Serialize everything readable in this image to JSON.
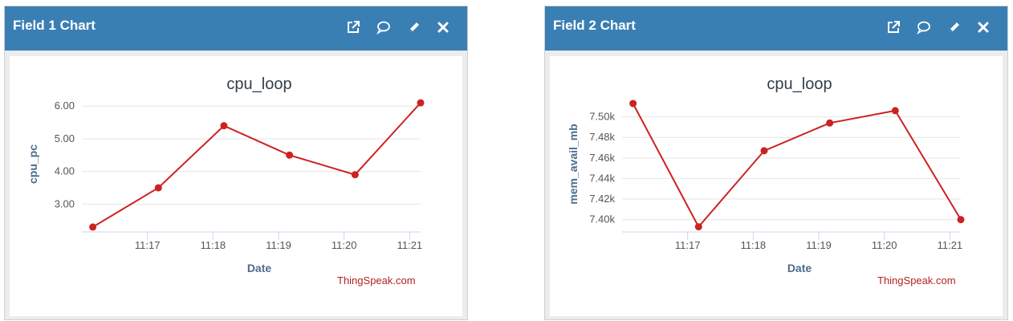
{
  "colors": {
    "header": "#3a7fb4",
    "series": "#cc2222",
    "credit": "#b22222"
  },
  "panels": [
    {
      "title": "Field 1 Chart",
      "icons": [
        "external-link-icon",
        "comment-icon",
        "pencil-icon",
        "close-icon"
      ],
      "credit": "ThingSpeak.com",
      "chart_data": {
        "type": "line",
        "title": "cpu_loop",
        "xlabel": "Date",
        "ylabel": "cpu_pc",
        "x_ticks": [
          "11:17",
          "11:18",
          "11:19",
          "11:20",
          "11:21"
        ],
        "y_ticks": [
          "3.00",
          "4.00",
          "5.00",
          "6.00"
        ],
        "x": [
          "11:16:10",
          "11:17:10",
          "11:18:10",
          "11:19:10",
          "11:20:10",
          "11:21:10"
        ],
        "series": [
          {
            "values": [
              2.3,
              3.5,
              5.4,
              4.5,
              3.9,
              6.1
            ]
          }
        ],
        "ylim": [
          2.15,
          6.3
        ],
        "grid": true
      }
    },
    {
      "title": "Field 2 Chart",
      "icons": [
        "external-link-icon",
        "comment-icon",
        "pencil-icon",
        "close-icon"
      ],
      "credit": "ThingSpeak.com",
      "chart_data": {
        "type": "line",
        "title": "cpu_loop",
        "xlabel": "Date",
        "ylabel": "mem_avail_mb",
        "x_ticks": [
          "11:17",
          "11:18",
          "11:19",
          "11:20",
          "11:21"
        ],
        "y_ticks": [
          "7.40k",
          "7.42k",
          "7.44k",
          "7.46k",
          "7.48k",
          "7.50k"
        ],
        "x": [
          "11:16:10",
          "11:17:10",
          "11:18:10",
          "11:19:10",
          "11:20:10",
          "11:21:10"
        ],
        "series": [
          {
            "values": [
              7513,
              7393,
              7467,
              7494,
              7506,
              7400
            ]
          }
        ],
        "ylim": [
          7388,
          7520
        ],
        "grid": true
      }
    }
  ]
}
